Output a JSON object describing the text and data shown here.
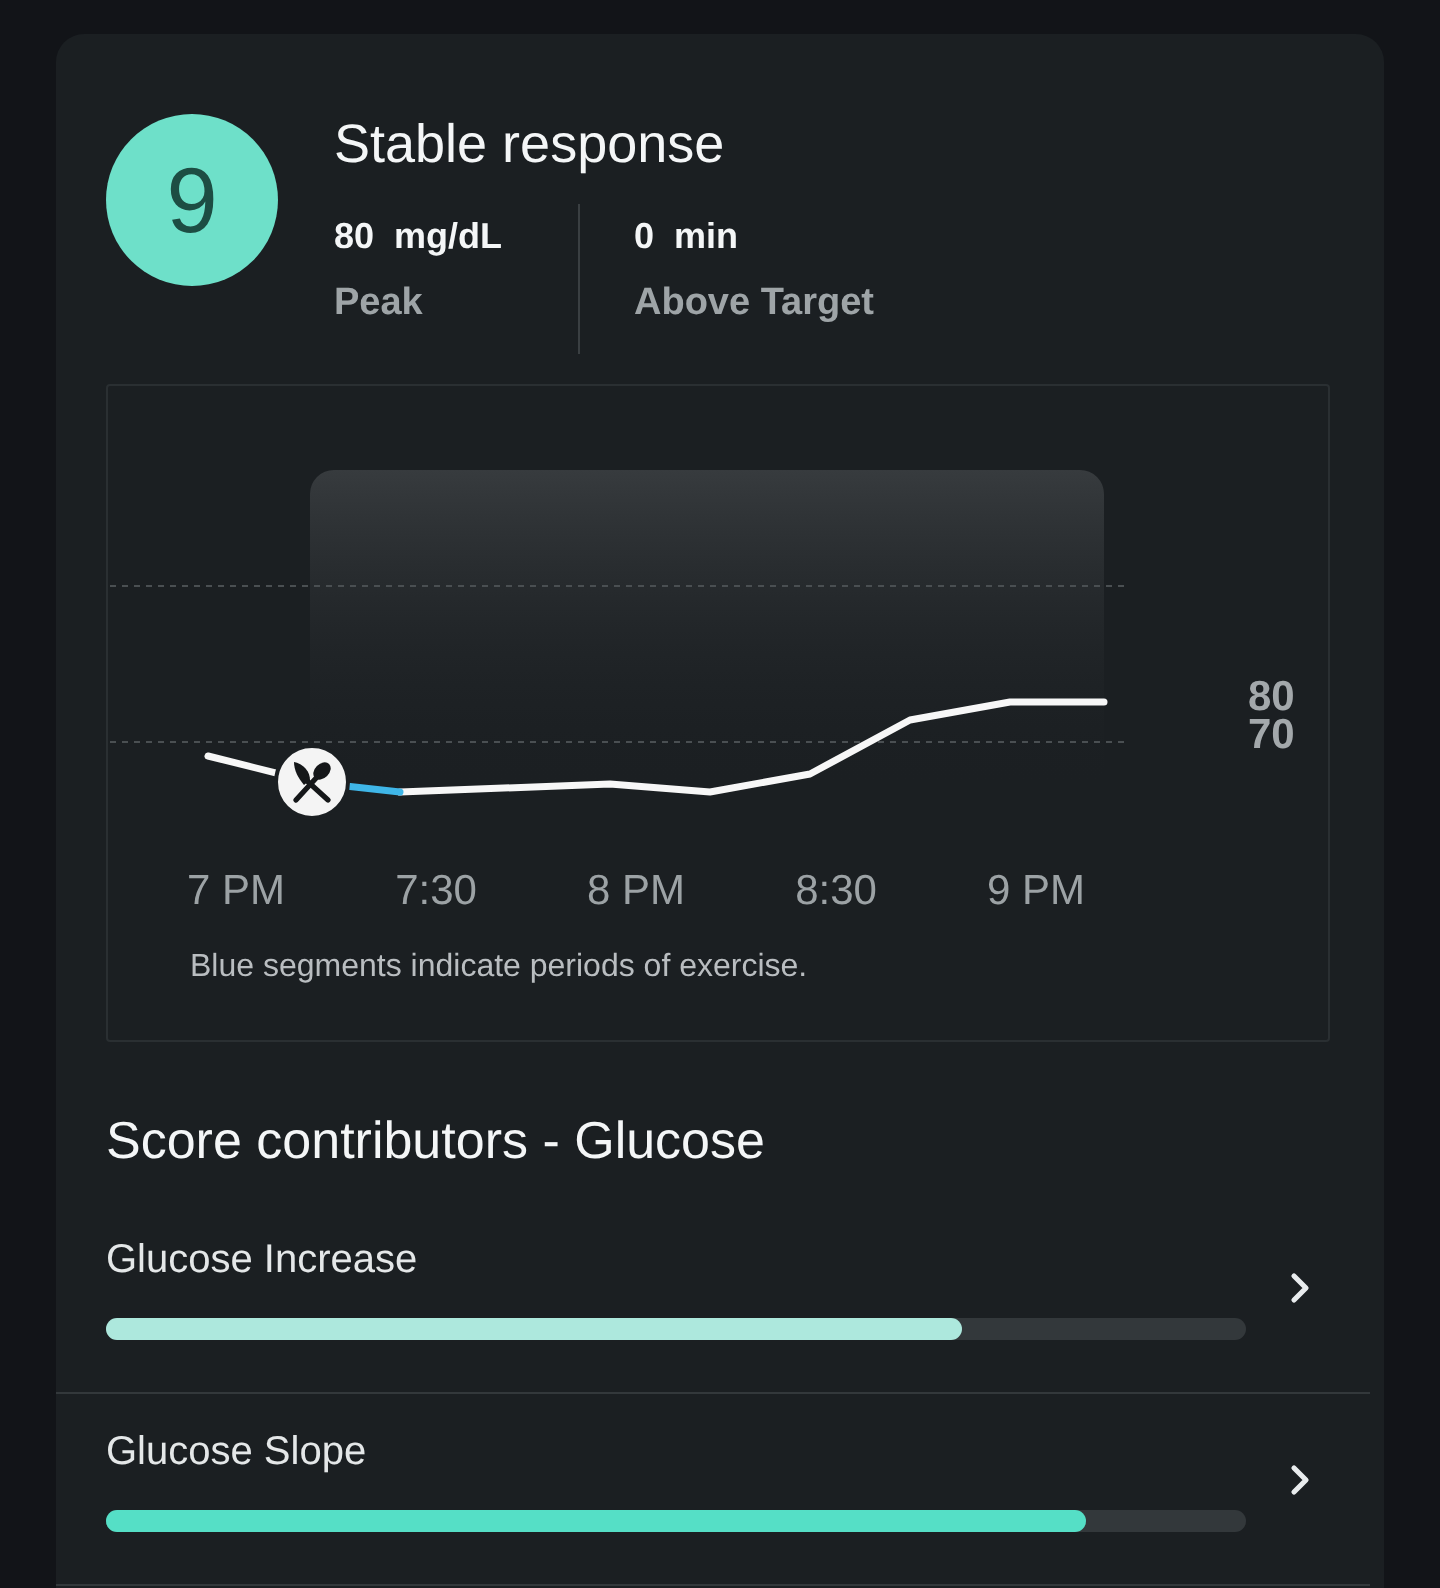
{
  "summary": {
    "score": "9",
    "title": "Stable response",
    "stats": [
      {
        "value": "80 mg/dL",
        "label": "Peak"
      },
      {
        "value": "0 min",
        "label": "Above Target"
      }
    ]
  },
  "chart": {
    "y_labels": [
      "80",
      "70"
    ],
    "x_labels": [
      "7 PM",
      "7:30",
      "8 PM",
      "8:30",
      "9 PM"
    ],
    "caption": "Blue segments indicate periods of exercise."
  },
  "contributors_title": "Score contributors - Glucose",
  "contributors": [
    {
      "label": "Glucose Increase",
      "level": 0.75,
      "color": "#ade8dd"
    },
    {
      "label": "Glucose Slope",
      "level": 0.86,
      "color": "#55dfc6"
    }
  ]
}
